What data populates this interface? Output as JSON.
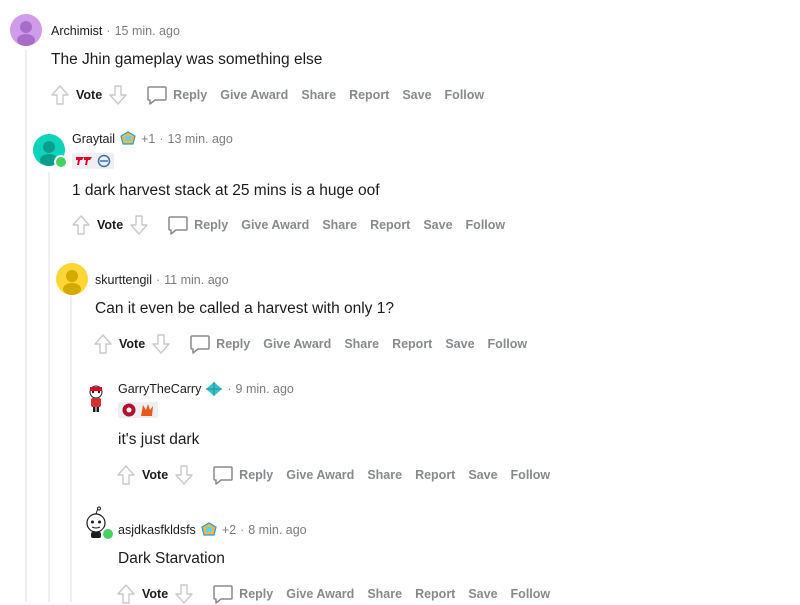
{
  "comments": [
    {
      "username": "Archimist",
      "time": "15 min. ago",
      "body": "The Jhin gameplay was something else",
      "award_count": ""
    },
    {
      "username": "Graytail",
      "award_count": "+1",
      "time": "13 min. ago",
      "body": "1 dark harvest stack at 25 mins is a huge oof"
    },
    {
      "username": "skurttengil",
      "time": "11 min. ago",
      "body": "Can it even be called a harvest with only 1?",
      "award_count": ""
    },
    {
      "username": "GarryTheCarry",
      "time": "9 min. ago",
      "body": "it's just dark",
      "award_count": ""
    },
    {
      "username": "asjdkasfkldsfs",
      "award_count": "+2",
      "time": "8 min. ago",
      "body": "Dark Starvation"
    }
  ],
  "separator": "·",
  "actions": {
    "vote": "Vote",
    "reply": "Reply",
    "give_award": "Give Award",
    "share": "Share",
    "report": "Report",
    "save": "Save",
    "follow": "Follow"
  },
  "colors": {
    "line": "#edeff1",
    "muted": "#878a8c",
    "online": "#46d160",
    "avatar_archimist": "#cf9bea",
    "avatar_graytail": "#0dd3bb",
    "avatar_skurttengil": "#ffd635"
  },
  "icons": [
    "upvote-icon",
    "downvote-icon",
    "reply-bubble-icon",
    "award-icon",
    "flair-icon"
  ]
}
